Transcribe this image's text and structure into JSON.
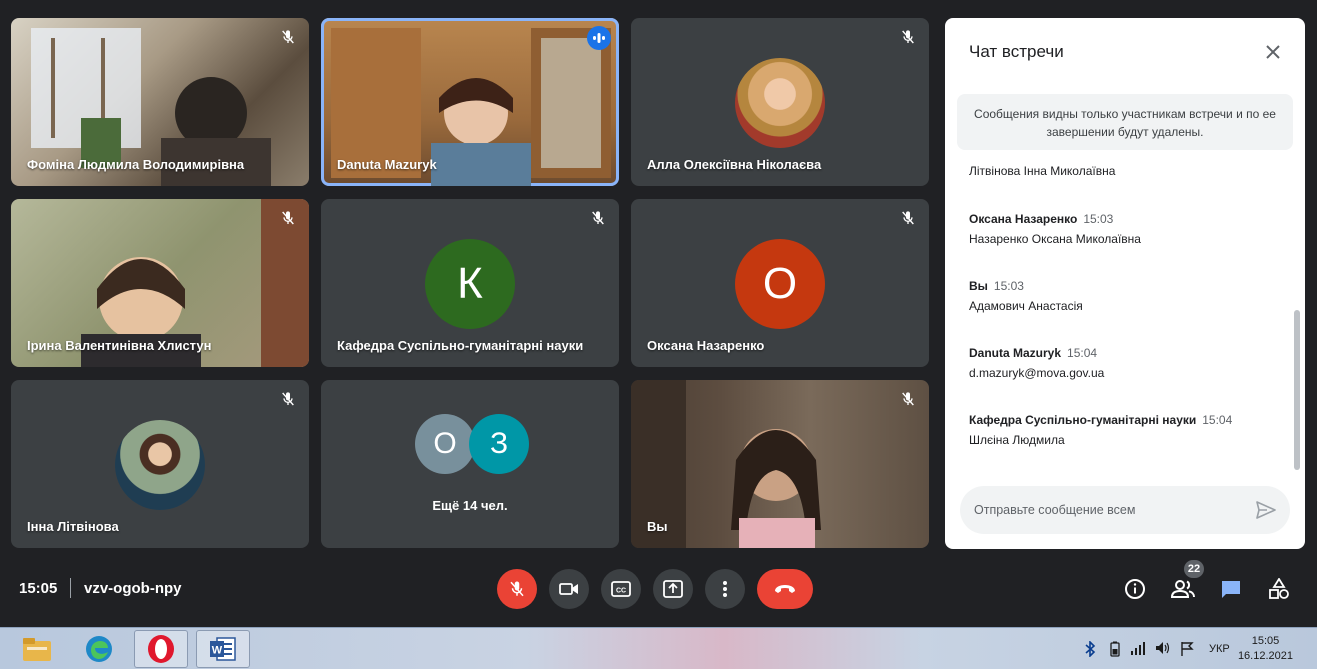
{
  "tiles": [
    {
      "name": "Фоміна Людмила Володимирівна"
    },
    {
      "name": "Danuta Mazuryk"
    },
    {
      "name": "Алла Олексіївна Ніколаєва"
    },
    {
      "name": "Ірина Валентинівна Хлистун"
    },
    {
      "name": "Кафедра Суспільно-гуманітарні науки",
      "initial": "К"
    },
    {
      "name": "Оксана Назаренко",
      "initial": "О"
    },
    {
      "name": "Інна Літвінова"
    },
    {
      "more": "Ещё 14 чел.",
      "initials": [
        "О",
        "З"
      ]
    },
    {
      "name": "Вы"
    }
  ],
  "colors": {
    "tile_bg": "#3c4043",
    "avatar_green": "#2d6a1f",
    "avatar_red": "#c5380f",
    "avatar_grey": "#78909c",
    "avatar_teal": "#0097a7",
    "active_outline": "#8ab4f8",
    "accent_blue": "#1a73e8",
    "hangup_red": "#ea4335"
  },
  "chat": {
    "title": "Чат встречи",
    "notice": "Сообщения видны только участникам встречи и по ее завершении будут удалены.",
    "messages": [
      {
        "sender": "",
        "time": "",
        "text": "Літвінова Інна Миколаївна"
      },
      {
        "sender": "Оксана Назаренко",
        "time": "15:03",
        "text": "Назаренко Оксана Миколаївна"
      },
      {
        "sender": "Вы",
        "time": "15:03",
        "text": "Адамович Анастасія"
      },
      {
        "sender": "Danuta Mazuryk",
        "time": "15:04",
        "text": "d.mazuryk@mova.gov.ua"
      },
      {
        "sender": "Кафедра Суспільно-гуманітарні науки",
        "time": "15:04",
        "text": "Шлєіна Людмила"
      }
    ],
    "placeholder": "Отправьте сообщение всем"
  },
  "bottom": {
    "time": "15:05",
    "meeting_code": "vzv-ogob-npy",
    "participants_count": "22"
  },
  "taskbar": {
    "language": "УКР",
    "time": "15:05",
    "date": "16.12.2021",
    "apps": [
      "file-explorer-icon",
      "edge-icon",
      "opera-icon",
      "word-icon"
    ]
  }
}
